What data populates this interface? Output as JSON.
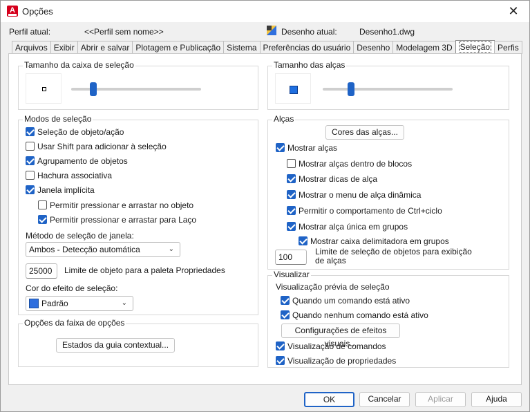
{
  "window": {
    "title": "Opções",
    "close_glyph": "✕",
    "app_icon_letter": "A"
  },
  "header": {
    "profile_label": "Perfil atual:",
    "profile_value": "<<Perfil sem nome>>",
    "drawing_label": "Desenho atual:",
    "drawing_value": "Desenho1.dwg"
  },
  "tabs": [
    {
      "label": "Arquivos"
    },
    {
      "label": "Exibir"
    },
    {
      "label": "Abrir e salvar"
    },
    {
      "label": "Plotagem e Publicação"
    },
    {
      "label": "Sistema"
    },
    {
      "label": "Preferências do usuário"
    },
    {
      "label": "Desenho"
    },
    {
      "label": "Modelagem 3D"
    },
    {
      "label": "Seleção",
      "active": true
    },
    {
      "label": "Perfis"
    }
  ],
  "left": {
    "pickbox": {
      "title": "Tamanho da caixa de seleção",
      "level_fraction": 0.17
    },
    "modes": {
      "title": "Modos de seleção",
      "items": [
        {
          "label": "Seleção de objeto/ação",
          "checked": true
        },
        {
          "label": "Usar Shift para adicionar à seleção",
          "checked": false
        },
        {
          "label": "Agrupamento de objetos",
          "checked": true
        },
        {
          "label": "Hachura associativa",
          "checked": false
        },
        {
          "label": "Janela implícita",
          "checked": true
        },
        {
          "label": "Permitir pressionar e arrastar no objeto",
          "checked": false
        },
        {
          "label": "Permitir pressionar e arrastar para Laço",
          "checked": true
        }
      ],
      "window_method_label": "Método de seleção de janela:",
      "window_method_value": "Ambos - Detecção automática",
      "object_limit_value": "25000",
      "object_limit_label": "Limite de objeto para a paleta Propriedades",
      "effect_color_label": "Cor do efeito de seleção:",
      "effect_color_value": "Padrão",
      "effect_color_swatch": "#2f6fde"
    },
    "ribbon": {
      "title": "Opções da faixa de opções",
      "button": "Estados da guia contextual..."
    }
  },
  "right": {
    "grip_size": {
      "title": "Tamanho das alças",
      "level_fraction": 0.22
    },
    "grips": {
      "title": "Alças",
      "colors_button": "Cores das alças...",
      "items": [
        {
          "label": "Mostrar alças",
          "checked": true
        },
        {
          "label": "Mostrar alças dentro de blocos",
          "checked": false
        },
        {
          "label": "Mostrar dicas de alça",
          "checked": true
        },
        {
          "label": "Mostrar o menu de alça dinâmica",
          "checked": true
        },
        {
          "label": "Permitir o comportamento de Ctrl+ciclo",
          "checked": true
        },
        {
          "label": "Mostrar alça única em grupos",
          "checked": true
        },
        {
          "label": "Mostrar caixa delimitadora em grupos",
          "checked": true
        }
      ],
      "limit_value": "100",
      "limit_label_line1": "Limite de seleção de objetos para exibição",
      "limit_label_line2": "de alças"
    },
    "preview": {
      "title": "Visualizar",
      "subtitle": "Visualização prévia de seleção",
      "items": [
        {
          "label": "Quando um comando está ativo",
          "checked": true
        },
        {
          "label": "Quando nenhum comando está ativo",
          "checked": true
        }
      ],
      "effects_button": "Configurações de efeitos visuais...",
      "items2": [
        {
          "label": "Visualização de comandos",
          "checked": true
        },
        {
          "label": "Visualização de propriedades",
          "checked": true
        }
      ]
    }
  },
  "footer": {
    "ok": "OK",
    "cancel": "Cancelar",
    "apply": "Aplicar",
    "help": "Ajuda"
  },
  "colors": {
    "accent": "#1f63c6",
    "app_icon": "#d6001c",
    "grip_blue": "#1f6fe0"
  }
}
